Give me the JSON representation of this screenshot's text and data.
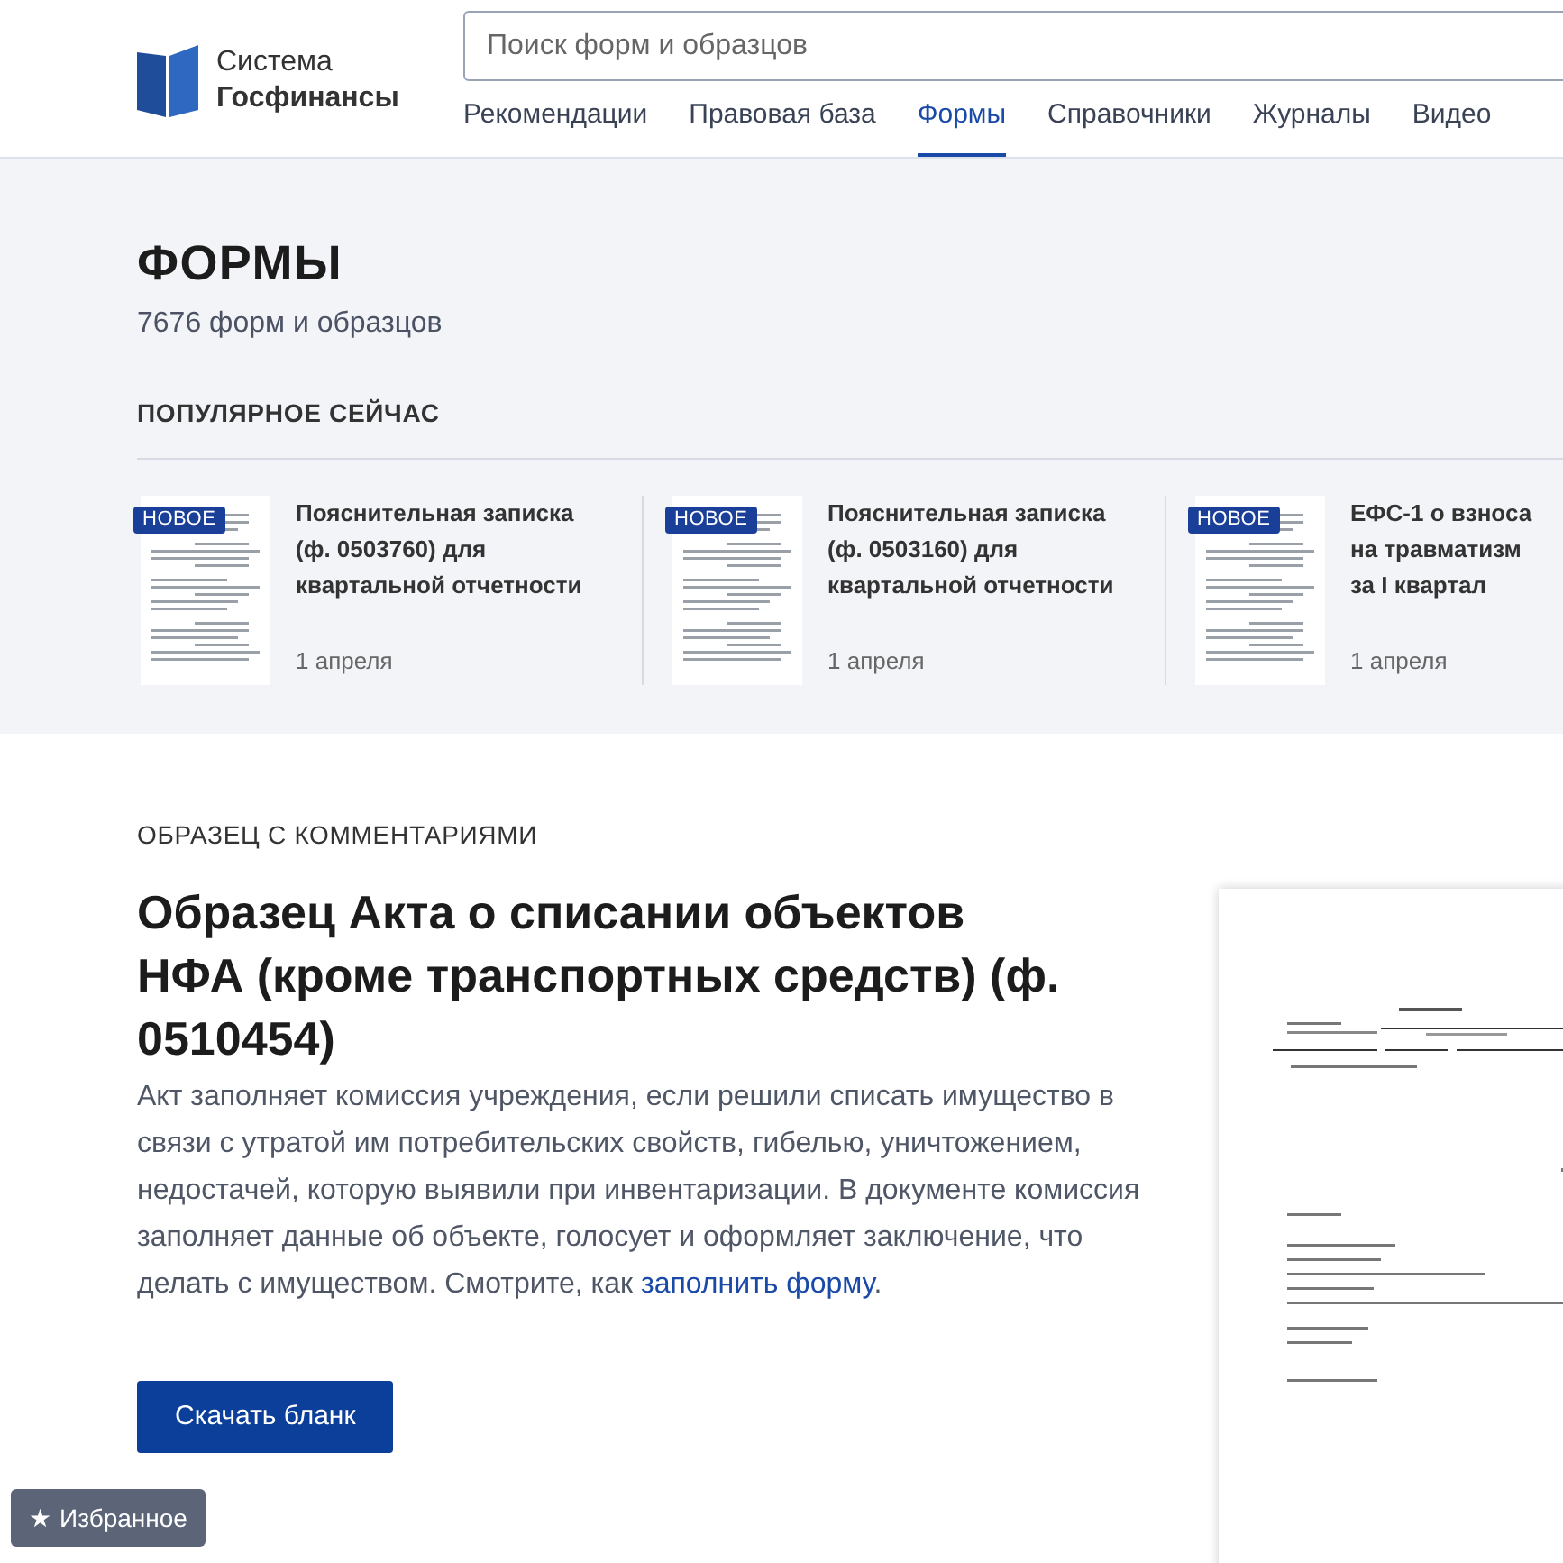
{
  "logo": {
    "line1": "Система",
    "line2": "Госфинансы"
  },
  "search": {
    "placeholder": "Поиск форм и образцов"
  },
  "nav": [
    {
      "label": "Рекомендации",
      "selected": false
    },
    {
      "label": "Правовая база",
      "selected": false
    },
    {
      "label": "Формы",
      "selected": true
    },
    {
      "label": "Справочники",
      "selected": false
    },
    {
      "label": "Журналы",
      "selected": false
    },
    {
      "label": "Видео",
      "selected": false
    }
  ],
  "page": {
    "title": "ФОРМЫ",
    "count": "7676 форм и образцов"
  },
  "popular": {
    "heading": "ПОПУЛЯРНОЕ СЕЙЧАС",
    "items": [
      {
        "badge": "НОВОЕ",
        "title_lines": [
          "Пояснительная записка",
          "(ф. 0503760) для",
          "квартальной отчетности"
        ],
        "date": "1 апреля"
      },
      {
        "badge": "НОВОЕ",
        "title_lines": [
          "Пояснительная записка",
          "(ф. 0503160) для",
          "квартальной отчетности"
        ],
        "date": "1 апреля"
      },
      {
        "badge": "НОВОЕ",
        "title_lines": [
          "ЕФС-1 о взноса",
          "на травматизм",
          "за I квартал"
        ],
        "date": "1 апреля"
      }
    ]
  },
  "sample": {
    "kicker": "ОБРАЗЕЦ С КОММЕНТАРИЯМИ",
    "title": "Образец Акта о списании объектов НФА (кроме транспортных средств) (ф. 0510454)",
    "text": "Акт заполняет комиссия учреждения, если решили списать имущество в связи с утратой им потребительских свойств, гибелью, уничтожением, недостачей, которую выявили при инвентаризации. В документе комиссия заполняет данные об объекте, голосует и оформляет заключение, что делать с имуществом. Смотрите, как",
    "link": "заполнить форму",
    "after_link": ".",
    "button": "Скачать бланк"
  },
  "favorites": {
    "icon": "★",
    "label": "Избранное"
  }
}
